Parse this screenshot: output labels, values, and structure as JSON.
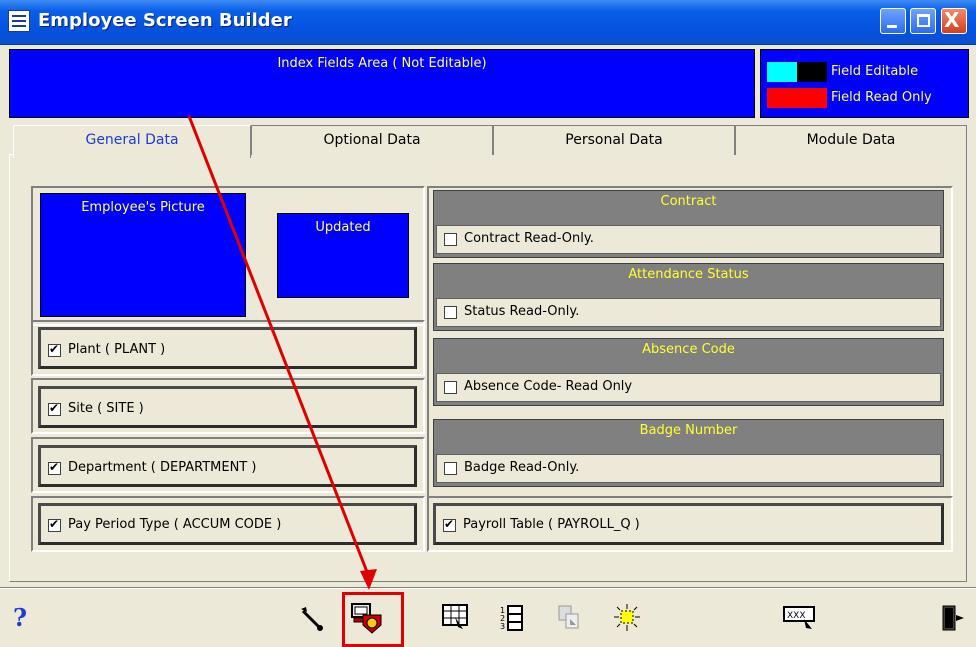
{
  "window": {
    "title": "Employee Screen Builder",
    "close_glyph": "X"
  },
  "index_area": {
    "label": "Index Fields Area ( Not Editable)"
  },
  "legend": {
    "editable_label": "Field Editable",
    "readonly_label": "Field Read Only",
    "editable_colors": [
      "#00ffff",
      "#000000"
    ],
    "readonly_color": "#ff0000"
  },
  "tabs": [
    {
      "label": "General Data",
      "active": true
    },
    {
      "label": "Optional Data",
      "active": false
    },
    {
      "label": "Personal Data",
      "active": false
    },
    {
      "label": "Module Data",
      "active": false
    }
  ],
  "general": {
    "picture_label": "Employee's Picture",
    "updated_label": "Updated",
    "fields": [
      {
        "label": "Plant ( PLANT )",
        "checked": true
      },
      {
        "label": "Site ( SITE )",
        "checked": true
      },
      {
        "label": "Department ( DEPARTMENT )",
        "checked": true
      },
      {
        "label": "Pay Period Type ( ACCUM CODE )",
        "checked": true
      }
    ],
    "sections": [
      {
        "title": "Contract",
        "checkbox_label": "Contract Read-Only.",
        "checked": false
      },
      {
        "title": "Attendance Status",
        "checkbox_label": "Status Read-Only.",
        "checked": false
      },
      {
        "title": "Absence Code",
        "checkbox_label": "Absence Code- Read Only",
        "checked": false
      },
      {
        "title": "Badge Number",
        "checkbox_label": "Badge Read-Only.",
        "checked": false
      }
    ],
    "payroll": {
      "label": "Payroll Table ( PAYROLL_Q )",
      "checked": true
    }
  },
  "toolbar": {
    "help": "?",
    "buttons": [
      "help-icon",
      "wrench-icon",
      "security-shield-icon",
      "grid-icon",
      "numbered-list-icon",
      "copy-icon",
      "sparkle-icon",
      "xxx-icon",
      "exit-door-icon"
    ]
  },
  "annotation": {
    "highlight_color": "#e00000"
  }
}
